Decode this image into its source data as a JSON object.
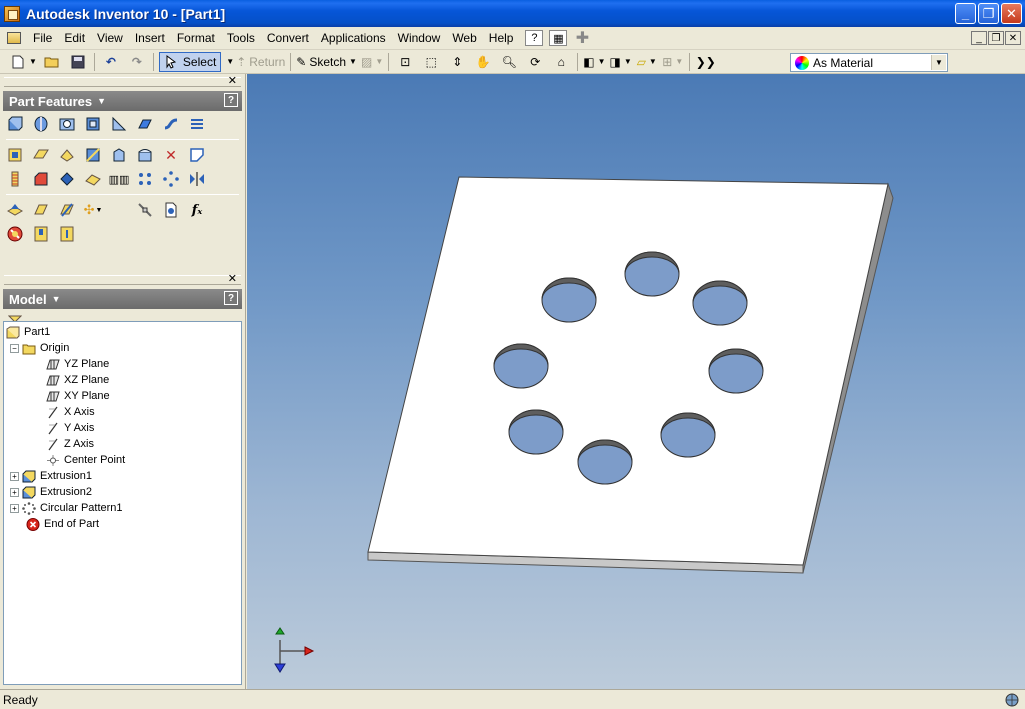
{
  "window": {
    "title": "Autodesk Inventor 10 - [Part1]"
  },
  "menu": [
    "File",
    "Edit",
    "View",
    "Insert",
    "Format",
    "Tools",
    "Convert",
    "Applications",
    "Window",
    "Web",
    "Help"
  ],
  "toolbar": {
    "select_label": "Select",
    "return_label": "Return",
    "sketch_label": "Sketch",
    "material_value": "As Material"
  },
  "part_features": {
    "title": "Part Features"
  },
  "model_panel": {
    "title": "Model"
  },
  "tree": {
    "root": "Part1",
    "origin": "Origin",
    "yz": "YZ Plane",
    "xz": "XZ Plane",
    "xy": "XY Plane",
    "xaxis": "X Axis",
    "yaxis": "Y Axis",
    "zaxis": "Z Axis",
    "center": "Center Point",
    "ext1": "Extrusion1",
    "ext2": "Extrusion2",
    "pattern": "Circular Pattern1",
    "end": "End of Part"
  },
  "status": {
    "text": "Ready"
  },
  "colors": {
    "title_blue": "#0756d8",
    "viewport_top": "#4b7ab5",
    "viewport_bottom": "#bccbda",
    "hole_blue": "#7d9cc9"
  }
}
